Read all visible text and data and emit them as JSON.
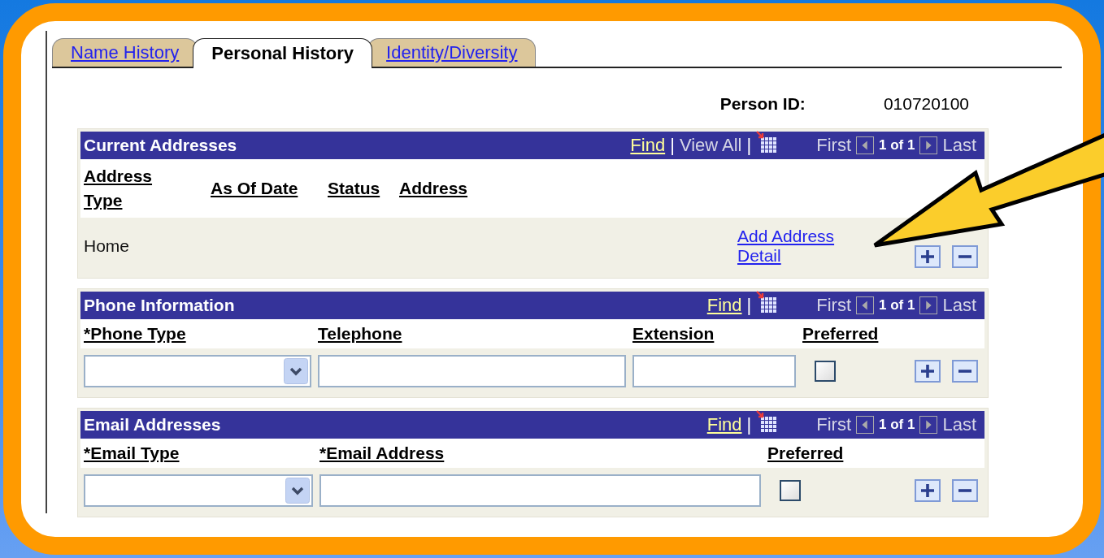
{
  "tabs": [
    {
      "label": "Name History",
      "selected": false
    },
    {
      "label": "Personal History",
      "selected": true
    },
    {
      "label": "Identity/Diversity",
      "selected": false
    }
  ],
  "person_id": {
    "label": "Person ID:",
    "value": "010720100"
  },
  "grids": [
    {
      "kind": "address",
      "title": "Current Addresses",
      "nav": [
        {
          "kind": "link",
          "text": "Find"
        },
        {
          "kind": "sep",
          "text": "|"
        },
        {
          "kind": "plain",
          "text": "View All"
        },
        {
          "kind": "sep",
          "text": "|"
        },
        {
          "kind": "grid_icon"
        },
        {
          "kind": "plain",
          "text": "First"
        },
        {
          "kind": "prev"
        },
        {
          "kind": "count",
          "text": "1 of 1"
        },
        {
          "kind": "next"
        },
        {
          "kind": "plain",
          "text": "Last"
        }
      ],
      "columns": [
        "Address Type",
        "As Of Date",
        "Status",
        "Address"
      ],
      "cells": [
        {
          "kind": "text",
          "text": "Home"
        },
        {
          "kind": "empty"
        },
        {
          "kind": "empty"
        },
        {
          "kind": "empty"
        },
        {
          "kind": "link",
          "text": "Add Address Detail"
        }
      ]
    },
    {
      "kind": "phone",
      "title": "Phone Information",
      "nav": [
        {
          "kind": "link",
          "text": "Find"
        },
        {
          "kind": "sep",
          "text": "|"
        },
        {
          "kind": "grid_icon"
        },
        {
          "kind": "plain",
          "text": "First"
        },
        {
          "kind": "prev"
        },
        {
          "kind": "count",
          "text": "1 of 1"
        },
        {
          "kind": "next"
        },
        {
          "kind": "plain",
          "text": "Last"
        }
      ],
      "columns": [
        "*Phone Type",
        "Telephone",
        "Extension",
        "Preferred"
      ],
      "cells": [
        {
          "kind": "select"
        },
        {
          "kind": "input"
        },
        {
          "kind": "input"
        },
        {
          "kind": "checkbox",
          "checked": false
        }
      ]
    },
    {
      "kind": "email",
      "title": "Email Addresses",
      "nav": [
        {
          "kind": "link",
          "text": "Find"
        },
        {
          "kind": "sep",
          "text": "|"
        },
        {
          "kind": "grid_icon"
        },
        {
          "kind": "plain",
          "text": "First"
        },
        {
          "kind": "prev"
        },
        {
          "kind": "count",
          "text": "1 of 1"
        },
        {
          "kind": "next"
        },
        {
          "kind": "plain",
          "text": "Last"
        }
      ],
      "columns": [
        "*Email Type",
        "*Email Address",
        "Preferred"
      ],
      "cells": [
        {
          "kind": "select"
        },
        {
          "kind": "input"
        },
        {
          "kind": "checkbox",
          "checked": false
        }
      ]
    }
  ]
}
